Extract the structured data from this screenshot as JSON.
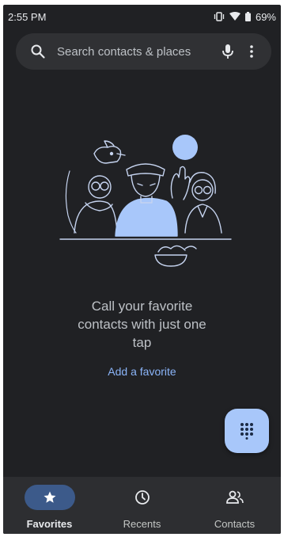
{
  "status": {
    "time": "2:55 PM",
    "battery": "69%"
  },
  "search": {
    "placeholder": "Search contacts & places"
  },
  "icons": {
    "search": "search-icon",
    "mic": "mic-icon",
    "menu": "more-vert-icon",
    "dialpad": "dialpad-icon"
  },
  "empty_state": {
    "line1": "Call your favorite",
    "line2": "contacts with just one",
    "line3": "tap",
    "action": "Add a favorite"
  },
  "nav": {
    "items": [
      {
        "label": "Favorites",
        "icon": "star-icon",
        "active": true
      },
      {
        "label": "Recents",
        "icon": "clock-icon",
        "active": false
      },
      {
        "label": "Contacts",
        "icon": "people-icon",
        "active": false
      }
    ]
  },
  "colors": {
    "background": "#202124",
    "accent": "#8ab4f8",
    "fab": "#a8c7fa",
    "nav_active": "#3c5a8a"
  }
}
